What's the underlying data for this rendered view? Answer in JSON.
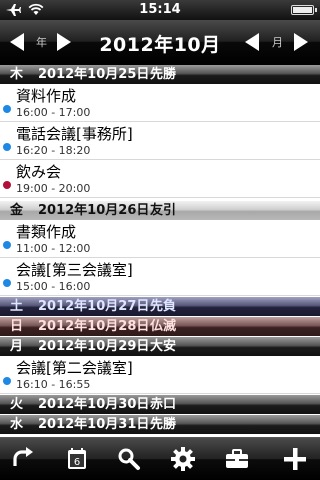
{
  "status_bar": {
    "time": "15:14",
    "icons": [
      "airplane-icon",
      "wifi-icon",
      "battery-icon"
    ],
    "battery_level": 1.0
  },
  "navbar": {
    "title": "2012年10月",
    "year_label": "年",
    "month_label": "月"
  },
  "days": [
    {
      "weekday": "木",
      "date": "2012年10月25日",
      "rokuyo": "先勝"
    },
    {
      "weekday": "金",
      "date": "2012年10月26日",
      "rokuyo": "友引"
    },
    {
      "weekday": "土",
      "date": "2012年10月27日",
      "rokuyo": "先負"
    },
    {
      "weekday": "日",
      "date": "2012年10月28日",
      "rokuyo": "仏滅"
    },
    {
      "weekday": "月",
      "date": "2012年10月29日",
      "rokuyo": "大安"
    },
    {
      "weekday": "火",
      "date": "2012年10月30日",
      "rokuyo": "赤口"
    },
    {
      "weekday": "水",
      "date": "2012年10月31日",
      "rokuyo": "先勝"
    }
  ],
  "events": [
    {
      "title": "資料作成",
      "time": "16:00 - 17:00",
      "color": "#1e88e5"
    },
    {
      "title": "電話会議[事務所]",
      "time": "16:20 - 18:20",
      "color": "#1e88e5"
    },
    {
      "title": "飲み会",
      "time": "19:00 - 20:00",
      "color": "#b0103a"
    },
    {
      "title": "書類作成",
      "time": "11:00 - 12:00",
      "color": "#1e88e5"
    },
    {
      "title": "会議[第三会議室]",
      "time": "15:00 - 16:00",
      "color": "#1e88e5"
    },
    {
      "title": "会議[第二会議室]",
      "time": "16:10 - 16:55",
      "color": "#1e88e5"
    }
  ],
  "toolbar": {
    "items": [
      "refresh-icon",
      "calendar-today-icon",
      "search-icon",
      "gear-icon",
      "toolbox-icon",
      "add-icon"
    ],
    "calendar_day": "6"
  }
}
